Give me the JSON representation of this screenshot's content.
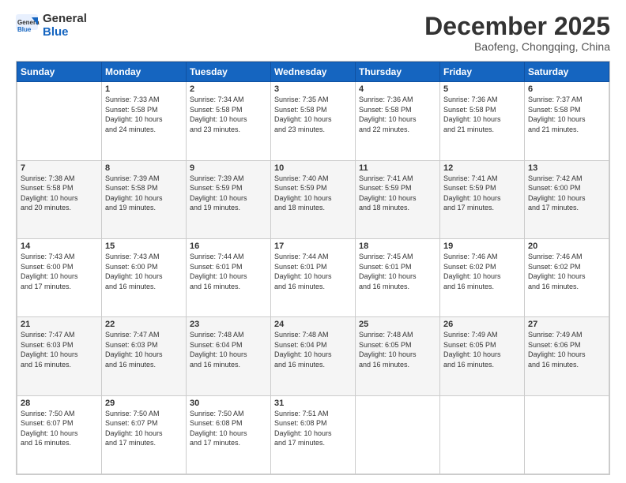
{
  "logo": {
    "general": "General",
    "blue": "Blue"
  },
  "title": "December 2025",
  "subtitle": "Baofeng, Chongqing, China",
  "weekdays": [
    "Sunday",
    "Monday",
    "Tuesday",
    "Wednesday",
    "Thursday",
    "Friday",
    "Saturday"
  ],
  "weeks": [
    [
      {
        "day": "",
        "info": ""
      },
      {
        "day": "1",
        "info": "Sunrise: 7:33 AM\nSunset: 5:58 PM\nDaylight: 10 hours\nand 24 minutes."
      },
      {
        "day": "2",
        "info": "Sunrise: 7:34 AM\nSunset: 5:58 PM\nDaylight: 10 hours\nand 23 minutes."
      },
      {
        "day": "3",
        "info": "Sunrise: 7:35 AM\nSunset: 5:58 PM\nDaylight: 10 hours\nand 23 minutes."
      },
      {
        "day": "4",
        "info": "Sunrise: 7:36 AM\nSunset: 5:58 PM\nDaylight: 10 hours\nand 22 minutes."
      },
      {
        "day": "5",
        "info": "Sunrise: 7:36 AM\nSunset: 5:58 PM\nDaylight: 10 hours\nand 21 minutes."
      },
      {
        "day": "6",
        "info": "Sunrise: 7:37 AM\nSunset: 5:58 PM\nDaylight: 10 hours\nand 21 minutes."
      }
    ],
    [
      {
        "day": "7",
        "info": "Sunrise: 7:38 AM\nSunset: 5:58 PM\nDaylight: 10 hours\nand 20 minutes."
      },
      {
        "day": "8",
        "info": "Sunrise: 7:39 AM\nSunset: 5:58 PM\nDaylight: 10 hours\nand 19 minutes."
      },
      {
        "day": "9",
        "info": "Sunrise: 7:39 AM\nSunset: 5:59 PM\nDaylight: 10 hours\nand 19 minutes."
      },
      {
        "day": "10",
        "info": "Sunrise: 7:40 AM\nSunset: 5:59 PM\nDaylight: 10 hours\nand 18 minutes."
      },
      {
        "day": "11",
        "info": "Sunrise: 7:41 AM\nSunset: 5:59 PM\nDaylight: 10 hours\nand 18 minutes."
      },
      {
        "day": "12",
        "info": "Sunrise: 7:41 AM\nSunset: 5:59 PM\nDaylight: 10 hours\nand 17 minutes."
      },
      {
        "day": "13",
        "info": "Sunrise: 7:42 AM\nSunset: 6:00 PM\nDaylight: 10 hours\nand 17 minutes."
      }
    ],
    [
      {
        "day": "14",
        "info": "Sunrise: 7:43 AM\nSunset: 6:00 PM\nDaylight: 10 hours\nand 17 minutes."
      },
      {
        "day": "15",
        "info": "Sunrise: 7:43 AM\nSunset: 6:00 PM\nDaylight: 10 hours\nand 16 minutes."
      },
      {
        "day": "16",
        "info": "Sunrise: 7:44 AM\nSunset: 6:01 PM\nDaylight: 10 hours\nand 16 minutes."
      },
      {
        "day": "17",
        "info": "Sunrise: 7:44 AM\nSunset: 6:01 PM\nDaylight: 10 hours\nand 16 minutes."
      },
      {
        "day": "18",
        "info": "Sunrise: 7:45 AM\nSunset: 6:01 PM\nDaylight: 10 hours\nand 16 minutes."
      },
      {
        "day": "19",
        "info": "Sunrise: 7:46 AM\nSunset: 6:02 PM\nDaylight: 10 hours\nand 16 minutes."
      },
      {
        "day": "20",
        "info": "Sunrise: 7:46 AM\nSunset: 6:02 PM\nDaylight: 10 hours\nand 16 minutes."
      }
    ],
    [
      {
        "day": "21",
        "info": "Sunrise: 7:47 AM\nSunset: 6:03 PM\nDaylight: 10 hours\nand 16 minutes."
      },
      {
        "day": "22",
        "info": "Sunrise: 7:47 AM\nSunset: 6:03 PM\nDaylight: 10 hours\nand 16 minutes."
      },
      {
        "day": "23",
        "info": "Sunrise: 7:48 AM\nSunset: 6:04 PM\nDaylight: 10 hours\nand 16 minutes."
      },
      {
        "day": "24",
        "info": "Sunrise: 7:48 AM\nSunset: 6:04 PM\nDaylight: 10 hours\nand 16 minutes."
      },
      {
        "day": "25",
        "info": "Sunrise: 7:48 AM\nSunset: 6:05 PM\nDaylight: 10 hours\nand 16 minutes."
      },
      {
        "day": "26",
        "info": "Sunrise: 7:49 AM\nSunset: 6:05 PM\nDaylight: 10 hours\nand 16 minutes."
      },
      {
        "day": "27",
        "info": "Sunrise: 7:49 AM\nSunset: 6:06 PM\nDaylight: 10 hours\nand 16 minutes."
      }
    ],
    [
      {
        "day": "28",
        "info": "Sunrise: 7:50 AM\nSunset: 6:07 PM\nDaylight: 10 hours\nand 16 minutes."
      },
      {
        "day": "29",
        "info": "Sunrise: 7:50 AM\nSunset: 6:07 PM\nDaylight: 10 hours\nand 17 minutes."
      },
      {
        "day": "30",
        "info": "Sunrise: 7:50 AM\nSunset: 6:08 PM\nDaylight: 10 hours\nand 17 minutes."
      },
      {
        "day": "31",
        "info": "Sunrise: 7:51 AM\nSunset: 6:08 PM\nDaylight: 10 hours\nand 17 minutes."
      },
      {
        "day": "",
        "info": ""
      },
      {
        "day": "",
        "info": ""
      },
      {
        "day": "",
        "info": ""
      }
    ]
  ]
}
